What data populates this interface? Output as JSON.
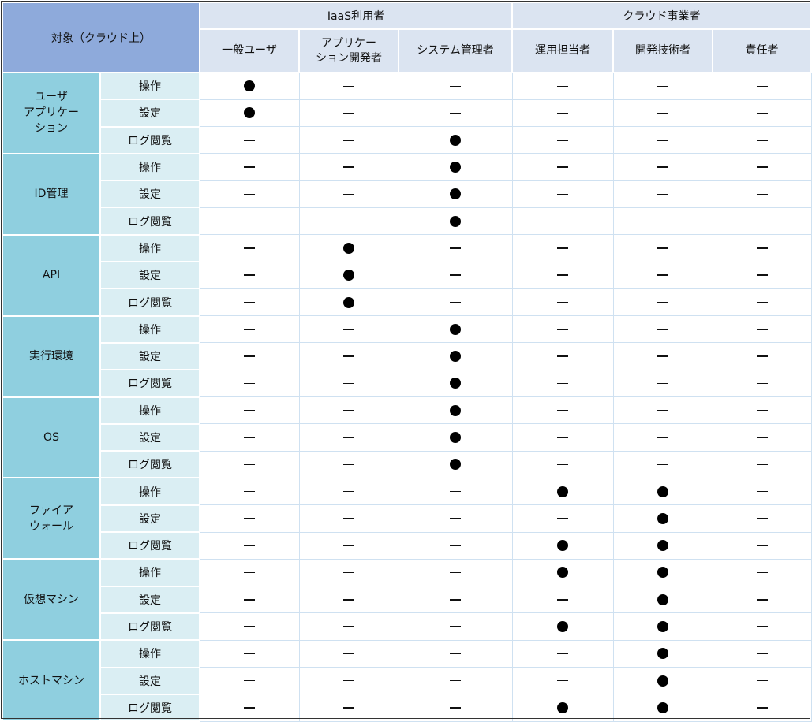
{
  "header": {
    "corner": "対象（クラウド上）",
    "groups": [
      "IaaS利用者",
      "クラウド事業者"
    ],
    "columns": [
      "一般ユーザ",
      "アプリケー\nション開発者",
      "システム管理者",
      "運用担当者",
      "開発技術者",
      "責任者"
    ]
  },
  "objects": [
    {
      "label": "ユーザ\nアプリケー\nション",
      "rows": [
        {
          "action": "操作",
          "marks": [
            "●",
            "−",
            "−",
            "−",
            "−",
            "−"
          ]
        },
        {
          "action": "設定",
          "marks": [
            "●",
            "−",
            "−",
            "−",
            "−",
            "−"
          ]
        },
        {
          "action": "ログ閲覧",
          "marks": [
            "−",
            "−",
            "●",
            "−",
            "−",
            "−"
          ]
        }
      ]
    },
    {
      "label": "ID管理",
      "rows": [
        {
          "action": "操作",
          "marks": [
            "−",
            "−",
            "●",
            "−",
            "−",
            "−"
          ]
        },
        {
          "action": "設定",
          "marks": [
            "−",
            "−",
            "●",
            "−",
            "−",
            "−"
          ]
        },
        {
          "action": "ログ閲覧",
          "marks": [
            "−",
            "−",
            "●",
            "−",
            "−",
            "−"
          ]
        }
      ]
    },
    {
      "label": "API",
      "rows": [
        {
          "action": "操作",
          "marks": [
            "−",
            "●",
            "−",
            "−",
            "−",
            "−"
          ]
        },
        {
          "action": "設定",
          "marks": [
            "−",
            "●",
            "−",
            "−",
            "−",
            "−"
          ]
        },
        {
          "action": "ログ閲覧",
          "marks": [
            "−",
            "●",
            "−",
            "−",
            "−",
            "−"
          ]
        }
      ]
    },
    {
      "label": "実行環境",
      "rows": [
        {
          "action": "操作",
          "marks": [
            "−",
            "−",
            "●",
            "−",
            "−",
            "−"
          ]
        },
        {
          "action": "設定",
          "marks": [
            "−",
            "−",
            "●",
            "−",
            "−",
            "−"
          ]
        },
        {
          "action": "ログ閲覧",
          "marks": [
            "−",
            "−",
            "●",
            "−",
            "−",
            "−"
          ]
        }
      ]
    },
    {
      "label": "OS",
      "rows": [
        {
          "action": "操作",
          "marks": [
            "−",
            "−",
            "●",
            "−",
            "−",
            "−"
          ]
        },
        {
          "action": "設定",
          "marks": [
            "−",
            "−",
            "●",
            "−",
            "−",
            "−"
          ]
        },
        {
          "action": "ログ閲覧",
          "marks": [
            "−",
            "−",
            "●",
            "−",
            "−",
            "−"
          ]
        }
      ]
    },
    {
      "label": "ファイア\nウォール",
      "rows": [
        {
          "action": "操作",
          "marks": [
            "−",
            "−",
            "−",
            "●",
            "●",
            "−"
          ]
        },
        {
          "action": "設定",
          "marks": [
            "−",
            "−",
            "−",
            "−",
            "●",
            "−"
          ]
        },
        {
          "action": "ログ閲覧",
          "marks": [
            "−",
            "−",
            "−",
            "●",
            "●",
            "−"
          ]
        }
      ]
    },
    {
      "label": "仮想マシン",
      "rows": [
        {
          "action": "操作",
          "marks": [
            "−",
            "−",
            "−",
            "●",
            "●",
            "−"
          ]
        },
        {
          "action": "設定",
          "marks": [
            "−",
            "−",
            "−",
            "−",
            "●",
            "−"
          ]
        },
        {
          "action": "ログ閲覧",
          "marks": [
            "−",
            "−",
            "−",
            "●",
            "●",
            "−"
          ]
        }
      ]
    },
    {
      "label": "ホストマシン",
      "rows": [
        {
          "action": "操作",
          "marks": [
            "−",
            "−",
            "−",
            "−",
            "●",
            "−"
          ]
        },
        {
          "action": "設定",
          "marks": [
            "−",
            "−",
            "−",
            "−",
            "●",
            "−"
          ]
        },
        {
          "action": "ログ閲覧",
          "marks": [
            "−",
            "−",
            "−",
            "●",
            "●",
            "−"
          ]
        }
      ]
    }
  ]
}
